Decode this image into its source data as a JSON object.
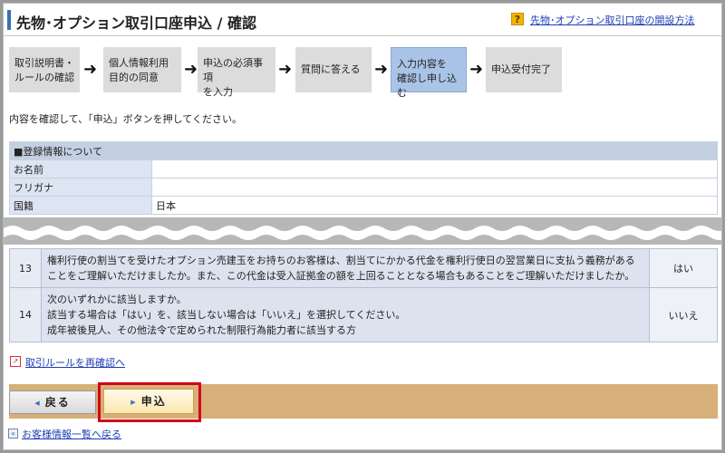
{
  "header": {
    "title": "先物･オプション取引口座申込 / 確認",
    "help_icon": "?",
    "help_link": "先物･オプション取引口座の開設方法"
  },
  "steps": [
    {
      "label": "取引説明書・\nルールの確認",
      "active": false
    },
    {
      "label": "個人情報利用\n目的の同意",
      "active": false
    },
    {
      "label": "申込の必須事項\nを入力",
      "active": false
    },
    {
      "label": "質問に答える",
      "active": false
    },
    {
      "label": "入力内容を\n確認し申し込む",
      "active": true
    },
    {
      "label": "申込受付完了",
      "active": false
    }
  ],
  "step_arrow": "➜",
  "instruction": "内容を確認して、「申込」ボタンを押してください。",
  "registration": {
    "heading": "■登録情報について",
    "rows": [
      {
        "label": "お名前",
        "value": ""
      },
      {
        "label": "フリガナ",
        "value": ""
      },
      {
        "label": "国籍",
        "value": "日本"
      }
    ]
  },
  "questions": [
    {
      "no": "13",
      "text": "権利行使の割当てを受けたオプション売建玉をお持ちのお客様は、割当てにかかる代金を権利行使日の翌営業日に支払う義務があることをご理解いただけましたか。また、この代金は受入証拠金の額を上回ることとなる場合もあることをご理解いただけましたか。",
      "answer": "はい"
    },
    {
      "no": "14",
      "text": "次のいずれかに該当しますか。\n該当する場合は「はい」を、該当しない場合は「いいえ」を選択してください。\n成年被後見人、その他法令で定められた制限行為能力者に該当する方",
      "answer": "いいえ"
    }
  ],
  "rule_link": "取引ルールを再確認へ",
  "buttons": {
    "back": "戻る",
    "apply": "申込"
  },
  "footer_link": "お客様情報一覧へ戻る",
  "colors": {
    "accent_blue": "#3a6fb6",
    "action_bar": "#d6b078",
    "highlight_red": "#d4001a",
    "active_step": "#a9c4e6"
  }
}
